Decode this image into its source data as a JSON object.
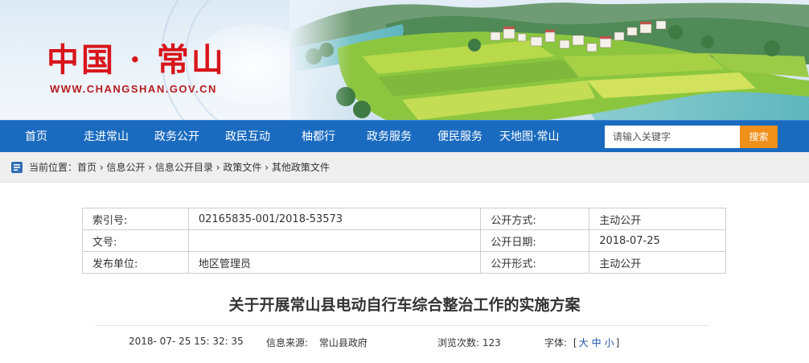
{
  "header": {
    "site_title": "中国 · 常山",
    "site_url": "WWW.CHANGSHAN.GOV.CN"
  },
  "nav": {
    "items": [
      {
        "label": "首页"
      },
      {
        "label": "走进常山"
      },
      {
        "label": "政务公开"
      },
      {
        "label": "政民互动"
      },
      {
        "label": "柚都行"
      },
      {
        "label": "政务服务"
      },
      {
        "label": "便民服务"
      },
      {
        "label": "天地图·常山"
      }
    ],
    "search_placeholder": "请输入关键字",
    "search_button": "搜索"
  },
  "breadcrumb": {
    "prefix": "当前位置：",
    "items": [
      "首页",
      "信息公开",
      "信息公开目录",
      "政策文件",
      "其他政策文件"
    ],
    "separator": " › "
  },
  "meta": {
    "index_label": "索引号:",
    "index_value": "02165835-001/2018-53573",
    "method_label": "公开方式:",
    "method_value": "主动公开",
    "docno_label": "文号:",
    "docno_value": "",
    "date_label": "公开日期:",
    "date_value": "2018-07-25",
    "publisher_label": "发布单位:",
    "publisher_value": "地区管理员",
    "form_label": "公开形式:",
    "form_value": "主动公开"
  },
  "article": {
    "title": "关于开展常山县电动自行车综合整治工作的实施方案",
    "datetime": "2018- 07- 25 15: 32: 35",
    "source_label": "信息来源:",
    "source_value": "常山县政府",
    "views_label": "浏览次数:",
    "views_value": "123",
    "font_label": "字体:",
    "font_open": "[",
    "font_large": "大",
    "font_medium": "中",
    "font_small": "小",
    "font_close": "]"
  },
  "colors": {
    "nav_bg": "#1a6bbf",
    "search_button": "#f08f1a",
    "logo_red": "#d8151b",
    "link_blue": "#1a55a8"
  }
}
